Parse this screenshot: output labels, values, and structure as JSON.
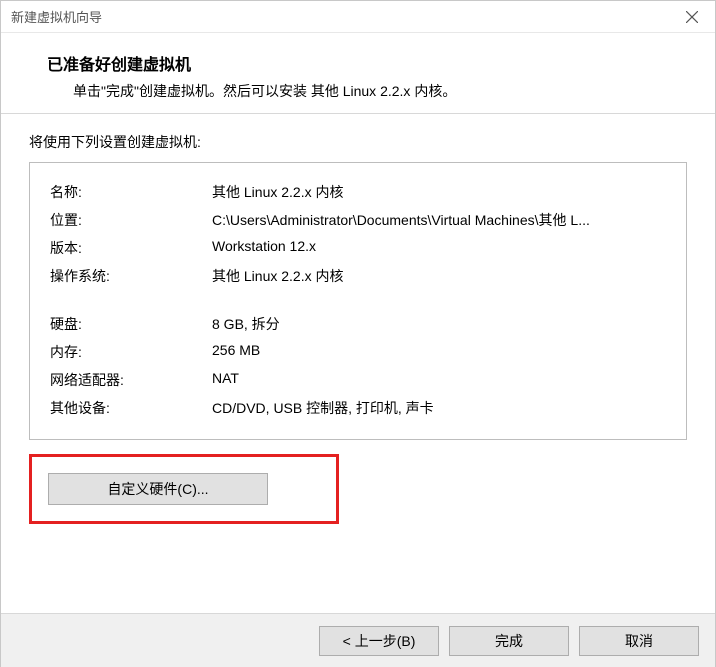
{
  "window": {
    "title": "新建虚拟机向导"
  },
  "header": {
    "title": "已准备好创建虚拟机",
    "subtitle": "单击\"完成\"创建虚拟机。然后可以安装 其他 Linux 2.2.x 内核。"
  },
  "intro": "将使用下列设置创建虚拟机:",
  "settings": {
    "name_label": "名称:",
    "name_value": "其他 Linux 2.2.x 内核",
    "location_label": "位置:",
    "location_value": "C:\\Users\\Administrator\\Documents\\Virtual Machines\\其他 L...",
    "version_label": "版本:",
    "version_value": "Workstation 12.x",
    "os_label": "操作系统:",
    "os_value": "其他 Linux 2.2.x 内核",
    "disk_label": "硬盘:",
    "disk_value": "8 GB, 拆分",
    "memory_label": "内存:",
    "memory_value": "256 MB",
    "network_label": "网络适配器:",
    "network_value": "NAT",
    "other_label": "其他设备:",
    "other_value": "CD/DVD, USB 控制器, 打印机, 声卡"
  },
  "buttons": {
    "customize": "自定义硬件(C)...",
    "back": "< 上一步(B)",
    "finish": "完成",
    "cancel": "取消"
  }
}
